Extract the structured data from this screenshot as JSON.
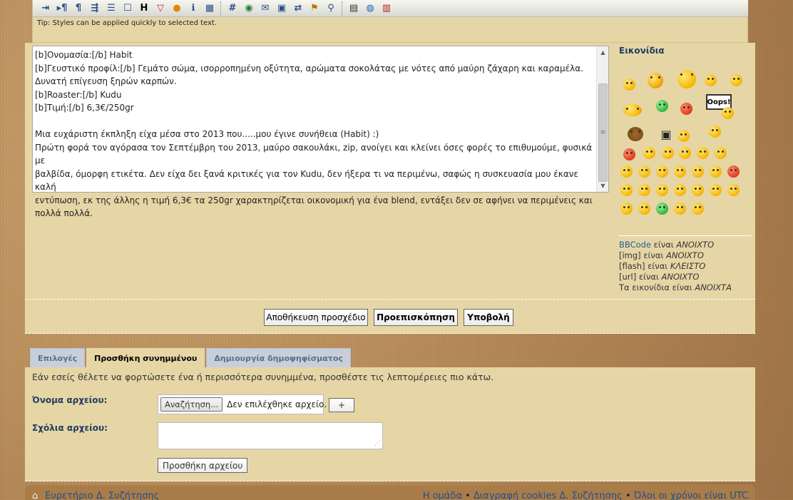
{
  "toolbar": {
    "icons": [
      "quote-icon",
      "list-icon",
      "paragraph-icon",
      "indent-icon",
      "outdent-icon",
      "blank-icon",
      "heading-icon",
      "warning-icon",
      "spoiler-icon",
      "info-icon",
      "table-icon",
      "hash-icon",
      "globe-icon",
      "mail-icon",
      "image-icon",
      "swap-icon",
      "flag-icon",
      "search-icon",
      "film-icon",
      "media-icon",
      "book-icon"
    ],
    "heading_glyph": "H",
    "tip": "Tip: Styles can be applied quickly to selected text."
  },
  "editor": {
    "lines": [
      "[b]Ονομασία:[/b] Habit",
      "[b]Γευστικό προφίλ:[/b] Γεμάτο σώμα, ισορροπημένη οξύτητα, αρώματα σοκολάτας με νότες από μαύρη ζάχαρη και καραμέλα.",
      "Δυνατή επίγευση ξηρών καρπών.",
      "[b]Roaster:[/b] Kudu",
      "[b]Τιμή:[/b] 6,3€/250gr",
      "",
      "Μια ευχάριστη έκπληξη είχα μέσα στο 2013 που.....μου έγινε συνήθεια (Habit) :)",
      "Πρώτη φορά τον αγόρασα τον Σεπτέμβρη του 2013, μαύρο σακουλάκι, zip, ανοίγει και κλείνει όσες φορές το επιθυμούμε, φυσικά με",
      "βαλβίδα, όμορφη ετικέτα. Δεν είχα δει ξανά κριτικές για τον Kudu, δεν ήξερα τι να περιμένω, σαφώς η συσκευασία μου έκανε καλή",
      "εντύπωση, εκ της άλλης η τιμή 6,3€ τα 250gr χαρακτηρίζεται οικονομική για ένα blend, εντάξει δεν σε αφήνει να περιμένεις και",
      "πολλά πολλά."
    ]
  },
  "smilies": {
    "title": "Εικονίδια",
    "oops_label": "Oops!"
  },
  "bbcode_status": {
    "bbcode_link": "BBCode",
    "bbcode_text": " είναι ",
    "bbcode_state": "ΑΝΟΙΧΤΟ",
    "img_text": "[img] είναι ",
    "img_state": "ΑΝΟΙΧΤΟ",
    "flash_text": "[flash] είναι ",
    "flash_state": "ΚΛΕΙΣΤΟ",
    "url_text": "[url] είναι ",
    "url_state": "ΑΝΟΙΧΤΟ",
    "smilies_text": "Τα εικονίδια είναι ",
    "smilies_state": "ΑΝΟΙΧΤΑ"
  },
  "buttons": {
    "save_draft": "Αποθήκευση προσχέδιο",
    "preview": "Προεπισκόπηση",
    "submit": "Υποβολή"
  },
  "tabs": {
    "options": "Επιλογές",
    "attachments": "Προσθήκη συνημμένου",
    "poll": "Δημιουργία δημοψηφίσματος"
  },
  "attachments": {
    "info": "Εάν εσείς θέλετε να φορτώσετε ένα ή περισσότερα συνημμένα, προσθέστε τις λεπτομέρειες πιο κάτω.",
    "filename_label": "Όνομα αρχείου:",
    "browse_label": "Αναζήτηση...",
    "no_file": "Δεν επιλέχθηκε αρχείο.",
    "plus_label": "+",
    "comment_label": "Σχόλια αρχείου:",
    "add_file": "Προσθήκη αρχείου"
  },
  "footer": {
    "board_index": "Ευρετήριο Δ. Συζήτησης",
    "team": "Η ομάδα",
    "delete_cookies": "Διαγραφή cookies Δ. Συζήτησης",
    "timezone": "Όλοι οι χρόνοι είναι UTC",
    "bullet": "•"
  }
}
